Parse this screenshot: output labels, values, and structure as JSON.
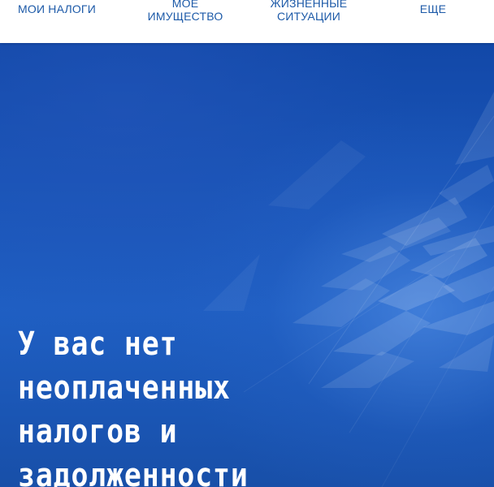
{
  "nav": {
    "items": [
      {
        "lines": [
          "МОИ НАЛОГИ"
        ]
      },
      {
        "lines": [
          "МОЁ",
          "ИМУЩЕСТВО"
        ]
      },
      {
        "lines": [
          "ЖИЗНЕННЫЕ",
          "СИТУАЦИИ"
        ]
      },
      {
        "lines": [
          "ЕЩЕ"
        ]
      }
    ]
  },
  "hero": {
    "headline_lines": [
      "У вас нет",
      "неоплаченных",
      "налогов и",
      "задолженности"
    ]
  },
  "colors": {
    "nav_text": "#1d5aa8",
    "hero_background": "#1a56b9",
    "headline_text": "#ffffff"
  }
}
